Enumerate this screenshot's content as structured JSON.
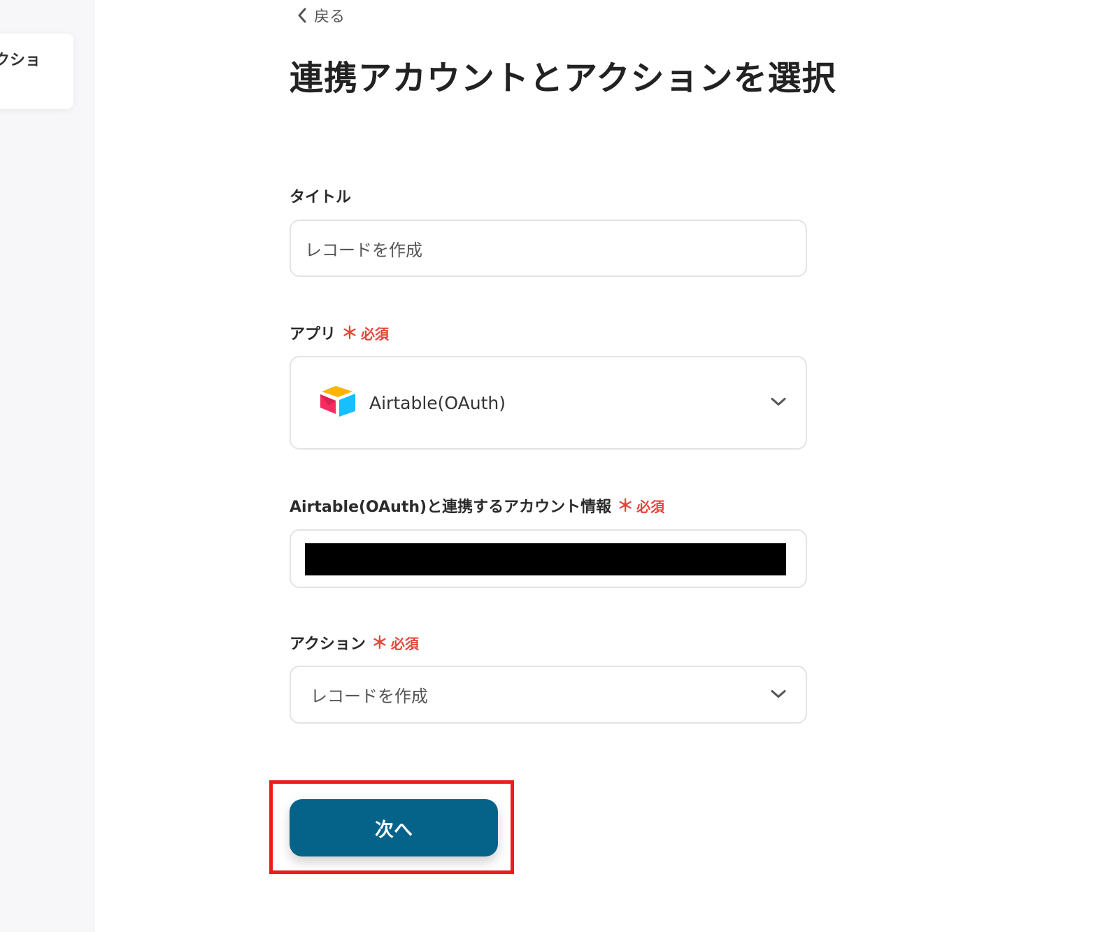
{
  "sidebar": {
    "card_label": "クショ"
  },
  "header": {
    "back_label": "戻る",
    "title": "連携アカウントとアクションを選択"
  },
  "form": {
    "title_field": {
      "label": "タイトル",
      "value": "レコードを作成"
    },
    "app_field": {
      "label": "アプリ",
      "required_mark": "＊",
      "required_label": "必須",
      "value": "Airtable(OAuth)",
      "icon": "airtable-logo-icon"
    },
    "account_field": {
      "label": "Airtable(OAuth)と連携するアカウント情報",
      "required_mark": "＊",
      "required_label": "必須"
    },
    "action_field": {
      "label": "アクション",
      "required_mark": "＊",
      "required_label": "必須",
      "value": "レコードを作成"
    },
    "next_button_label": "次へ"
  },
  "colors": {
    "accent": "#05638a",
    "required": "#e8433c",
    "highlight": "#ec1c1c"
  }
}
